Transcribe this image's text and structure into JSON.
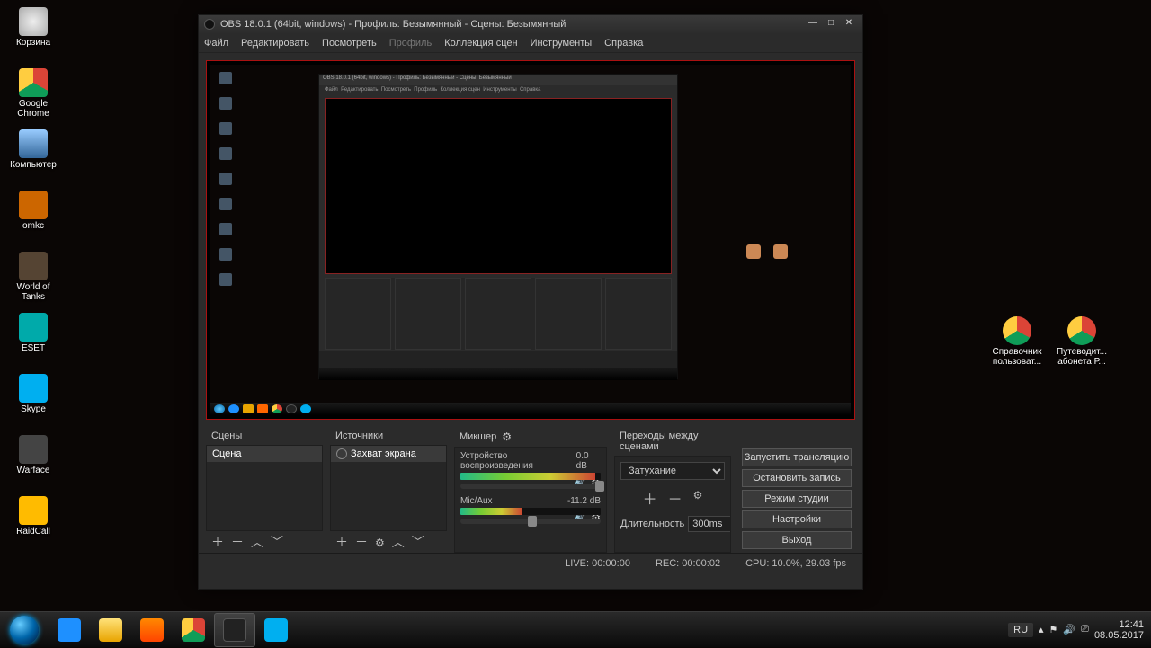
{
  "desktop_icons_left": [
    {
      "label": "Корзина",
      "cls": "c-trash"
    },
    {
      "label": "Google Chrome",
      "cls": "c-chrome"
    },
    {
      "label": "Компьютер",
      "cls": "c-pc"
    },
    {
      "label": "omkc",
      "cls": "c-omkc"
    },
    {
      "label": "World of Tanks",
      "cls": "c-wot"
    },
    {
      "label": "ESET",
      "cls": "c-eset"
    },
    {
      "label": "Skype",
      "cls": "c-skype"
    },
    {
      "label": "Warface",
      "cls": "c-wf"
    },
    {
      "label": "RaidCall",
      "cls": "c-rc"
    }
  ],
  "desktop_icons_right": [
    {
      "label": "Справочник пользоват...",
      "cls": "c-doc"
    },
    {
      "label": "Путеводит... абонета Р...",
      "cls": "c-doc"
    }
  ],
  "obs": {
    "title": "OBS 18.0.1 (64bit, windows) - Профиль: Безымянный - Сцены: Безымянный",
    "menu": [
      "Файл",
      "Редактировать",
      "Посмотреть",
      "Профиль",
      "Коллекция сцен",
      "Инструменты",
      "Справка"
    ],
    "menu_disabled": "Профиль",
    "panels": {
      "scenes": {
        "title": "Сцены",
        "items": [
          "Сцена"
        ]
      },
      "sources": {
        "title": "Источники",
        "items": [
          "Захват экрана"
        ]
      },
      "mixer": {
        "title": "Микшер",
        "channels": [
          {
            "name": "Устройство воспроизведения",
            "db": "0.0 dB",
            "meter": 96,
            "knob": 96
          },
          {
            "name": "Mic/Aux",
            "db": "-11.2 dB",
            "meter": 44,
            "knob": 48
          }
        ]
      },
      "transitions": {
        "title": "Переходы между сценами",
        "current": "Затухание",
        "duration_label": "Длительность",
        "duration_value": "300ms"
      },
      "controls": {
        "buttons": [
          "Запустить трансляцию",
          "Остановить запись",
          "Режим студии",
          "Настройки",
          "Выход"
        ]
      }
    },
    "status": {
      "live": "LIVE: 00:00:00",
      "rec": "REC: 00:00:02",
      "cpu": "CPU: 10.0%, 29.03 fps"
    }
  },
  "taskbar": {
    "pinned": [
      {
        "name": "ie",
        "cls": "c-ie"
      },
      {
        "name": "explorer",
        "cls": "c-folder"
      },
      {
        "name": "wmp",
        "cls": "c-wmp"
      },
      {
        "name": "chrome",
        "cls": "c-chrome"
      },
      {
        "name": "obs",
        "cls": "c-obs",
        "active": true
      },
      {
        "name": "skype",
        "cls": "c-skype"
      }
    ],
    "lang": "RU",
    "time": "12:41",
    "date": "08.05.2017"
  }
}
